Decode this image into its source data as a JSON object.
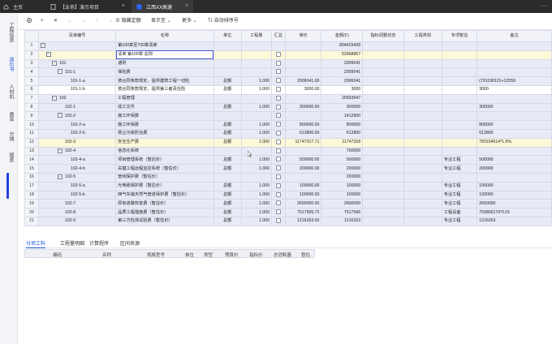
{
  "tabs": [
    {
      "label": "主页",
      "active": false
    },
    {
      "label": "【业务】演示项目",
      "active": false
    },
    {
      "label": "江西XX高速",
      "active": true
    }
  ],
  "sidebar": [
    {
      "label": "工程信息",
      "active": false
    },
    {
      "label": "造价书",
      "active": true
    },
    {
      "label": "人材机",
      "active": false
    },
    {
      "label": "费率",
      "active": false
    },
    {
      "label": "分摊",
      "active": false
    },
    {
      "label": "报表",
      "active": false
    }
  ],
  "toolbar": {
    "hide_quota": "隐藏定额",
    "display_to": "显示至",
    "more": "更多",
    "renumber": "自动排序号"
  },
  "columns": [
    "清单编号",
    "名称",
    "单位",
    "工程量",
    "汇总",
    "单价",
    "金额(F)",
    "指标调整状态",
    "工程类别",
    "专项暂估",
    "备注"
  ],
  "rows": [
    {
      "n": "1",
      "code": "",
      "name": "第100章至700章清单",
      "unit": "",
      "qty": "",
      "check": false,
      "price": "",
      "amount": "804425439",
      "cat": "",
      "spec": "",
      "note": "",
      "style": "lav",
      "level": 0,
      "toggle": "-"
    },
    {
      "n": "2",
      "code": "",
      "name": "清单 第100章 总则",
      "unit": "",
      "qty": "",
      "check": true,
      "price": "",
      "amount": "52668867",
      "cat": "",
      "spec": "",
      "note": "",
      "style": "yel",
      "level": 1,
      "toggle": "-",
      "edit": true
    },
    {
      "n": "3",
      "code": "101",
      "name": "通则",
      "unit": "",
      "qty": "",
      "check": true,
      "price": "",
      "amount": "2009041",
      "cat": "",
      "spec": "",
      "note": "",
      "style": "lav",
      "level": 2,
      "toggle": "-"
    },
    {
      "n": "4",
      "code": "101-1",
      "name": "保险费",
      "unit": "",
      "qty": "",
      "check": true,
      "price": "",
      "amount": "2009041",
      "cat": "",
      "spec": "",
      "note": "",
      "style": "lav",
      "level": 3,
      "toggle": "-"
    },
    {
      "n": "5",
      "code": "101-1-a",
      "name": "按合同条款规定，提供建筑工程一切险",
      "unit": "总额",
      "qty": "1.000",
      "check": true,
      "price": "2006041.00",
      "amount": "2006041",
      "cat": "",
      "spec": "",
      "note": "(791198121+12559",
      "style": "lav",
      "level": 4,
      "toggle": ""
    },
    {
      "n": "6",
      "code": "101-1-b",
      "name": "按合同条款规定，提供第三者责任险",
      "unit": "总额",
      "qty": "1.000",
      "check": true,
      "price": "3000.00",
      "amount": "3000",
      "cat": "",
      "spec": "",
      "note": "3000",
      "style": "wht",
      "level": 4,
      "toggle": ""
    },
    {
      "n": "7",
      "code": "102",
      "name": "工程管理",
      "unit": "",
      "qty": "",
      "check": true,
      "price": "",
      "amount": "25693947",
      "cat": "",
      "spec": "",
      "note": "",
      "style": "lav",
      "level": 2,
      "toggle": "-"
    },
    {
      "n": "8",
      "code": "102-1",
      "name": "竣工文件",
      "unit": "总额",
      "qty": "1.000",
      "check": true,
      "price": "300000.00",
      "amount": "300000",
      "cat": "",
      "spec": "",
      "note": "300000",
      "style": "lav",
      "level": 3,
      "toggle": ""
    },
    {
      "n": "9",
      "code": "102-2",
      "name": "施工环保费",
      "unit": "",
      "qty": "",
      "check": true,
      "price": "",
      "amount": "1412800",
      "cat": "",
      "spec": "",
      "note": "",
      "style": "lav",
      "level": 3,
      "toggle": "-"
    },
    {
      "n": "10",
      "code": "102-2-a",
      "name": "施工环保费",
      "unit": "总额",
      "qty": "1.000",
      "check": true,
      "price": "800000.00",
      "amount": "800000",
      "cat": "",
      "spec": "",
      "note": "800000",
      "style": "lav",
      "level": 4,
      "toggle": ""
    },
    {
      "n": "11",
      "code": "102-2-b",
      "name": "扬尘污染防治费",
      "unit": "总额",
      "qty": "1.000",
      "check": true,
      "price": "612800.00",
      "amount": "612800",
      "cat": "",
      "spec": "",
      "note": "612800",
      "style": "lav",
      "level": 4,
      "toggle": ""
    },
    {
      "n": "12",
      "code": "102-3",
      "name": "安全生产费",
      "unit": "总额",
      "qty": "1.000",
      "check": true,
      "price": "11747317.71",
      "amount": "11747318",
      "cat": "",
      "spec": "",
      "note": "783154514*1.5%",
      "style": "yel",
      "level": 3,
      "toggle": ""
    },
    {
      "n": "13",
      "code": "102-4",
      "name": "信息化系统",
      "unit": "",
      "qty": "",
      "check": true,
      "price": "",
      "amount": "700000",
      "cat": "",
      "spec": "",
      "note": "",
      "style": "lav",
      "level": 3,
      "toggle": "-"
    },
    {
      "n": "14",
      "code": "102-4-a",
      "name": "项目管理系统（暂估价）",
      "unit": "总额",
      "qty": "1.000",
      "check": true,
      "price": "500000.00",
      "amount": "500000",
      "cat": "",
      "spec": "专业工程",
      "note": "500000",
      "style": "lav",
      "level": 4,
      "toggle": ""
    },
    {
      "n": "15",
      "code": "102-4-b",
      "name": "关键工程远程监控系统（暂估价）",
      "unit": "总额",
      "qty": "1.000",
      "check": true,
      "price": "200000.00",
      "amount": "200000",
      "cat": "",
      "spec": "专业工程",
      "note": "200000",
      "style": "lav",
      "level": 4,
      "toggle": ""
    },
    {
      "n": "16",
      "code": "102-5",
      "name": "管线保护费（暂估价）",
      "unit": "",
      "qty": "",
      "check": true,
      "price": "",
      "amount": "200000",
      "cat": "",
      "spec": "",
      "note": "",
      "style": "lav",
      "level": 3,
      "toggle": "-"
    },
    {
      "n": "17",
      "code": "102-5-a",
      "name": "光电缆保护费（暂估价）",
      "unit": "总额",
      "qty": "1.000",
      "check": true,
      "price": "100000.00",
      "amount": "100000",
      "cat": "",
      "spec": "专业工程",
      "note": "100000",
      "style": "lav",
      "level": 4,
      "toggle": ""
    },
    {
      "n": "18",
      "code": "102-5-b",
      "name": "西气东输天然气管道保护费（暂估价）",
      "unit": "总额",
      "qty": "1.000",
      "check": true,
      "price": "100000.00",
      "amount": "100000",
      "cat": "",
      "spec": "专业工程",
      "note": "100000",
      "style": "lav",
      "level": 4,
      "toggle": ""
    },
    {
      "n": "19",
      "code": "102-7",
      "name": "原有道路恢复费（暂估价）",
      "unit": "总额",
      "qty": "1.000",
      "check": true,
      "price": "2600000.00",
      "amount": "2600000",
      "cat": "",
      "spec": "专业工程",
      "note": "2600000",
      "style": "lav",
      "level": 3,
      "toggle": ""
    },
    {
      "n": "20",
      "code": "102-8",
      "name": "品质工程措施费（暂估价）",
      "unit": "总额",
      "qty": "1.000",
      "check": true,
      "price": "7517565.72",
      "amount": "7517566",
      "cat": "",
      "spec": "工程设备",
      "note": "759800179*0.01",
      "style": "lav",
      "level": 3,
      "toggle": ""
    },
    {
      "n": "21",
      "code": "102-9",
      "name": "第三方检测试验费（暂估价）",
      "unit": "总额",
      "qty": "1.000",
      "check": true,
      "price": "1216263.00",
      "amount": "1216263",
      "cat": "",
      "spec": "专业工程",
      "note": "1216263",
      "style": "lav",
      "level": 3,
      "toggle": ""
    }
  ],
  "bottom_tabs": [
    {
      "label": "分项工料",
      "active": true
    },
    {
      "label": "工程量明细",
      "active": false
    },
    {
      "label": "计算程序",
      "active": false
    },
    {
      "label": "区间来源",
      "active": false
    }
  ],
  "lower_columns": [
    "编码",
    "名称",
    "规格型号",
    "单位",
    "类型",
    "预算价",
    "指标价",
    "总消耗量",
    "暂估"
  ]
}
